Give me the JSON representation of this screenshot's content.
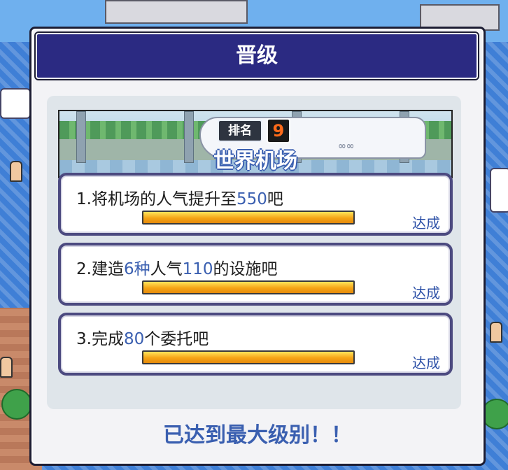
{
  "dialog": {
    "title": "晋级",
    "banner": {
      "rank_label": "排名",
      "rank_value": "9",
      "title": "世界机场"
    },
    "tasks": [
      {
        "prefix": "1.将机场的人气提升至",
        "highlight": "550",
        "suffix": "吧",
        "middle": "",
        "highlight2": "",
        "progress": 1.0,
        "status": "达成"
      },
      {
        "prefix": "2.建造",
        "highlight": "6种",
        "middle": "人气",
        "highlight2": "110",
        "suffix": "的设施吧",
        "progress": 1.0,
        "status": "达成"
      },
      {
        "prefix": "3.完成",
        "highlight": "80",
        "suffix": "个委托吧",
        "middle": "",
        "highlight2": "",
        "progress": 1.0,
        "status": "达成"
      }
    ],
    "footer": "已达到最大级别！！"
  },
  "colors": {
    "title_bar": "#2b2a82",
    "highlight": "#3a5fb0",
    "task_border": "#4c4a80",
    "progress_fill": "#f5a516",
    "rank_badge": "#ff6b1a"
  }
}
